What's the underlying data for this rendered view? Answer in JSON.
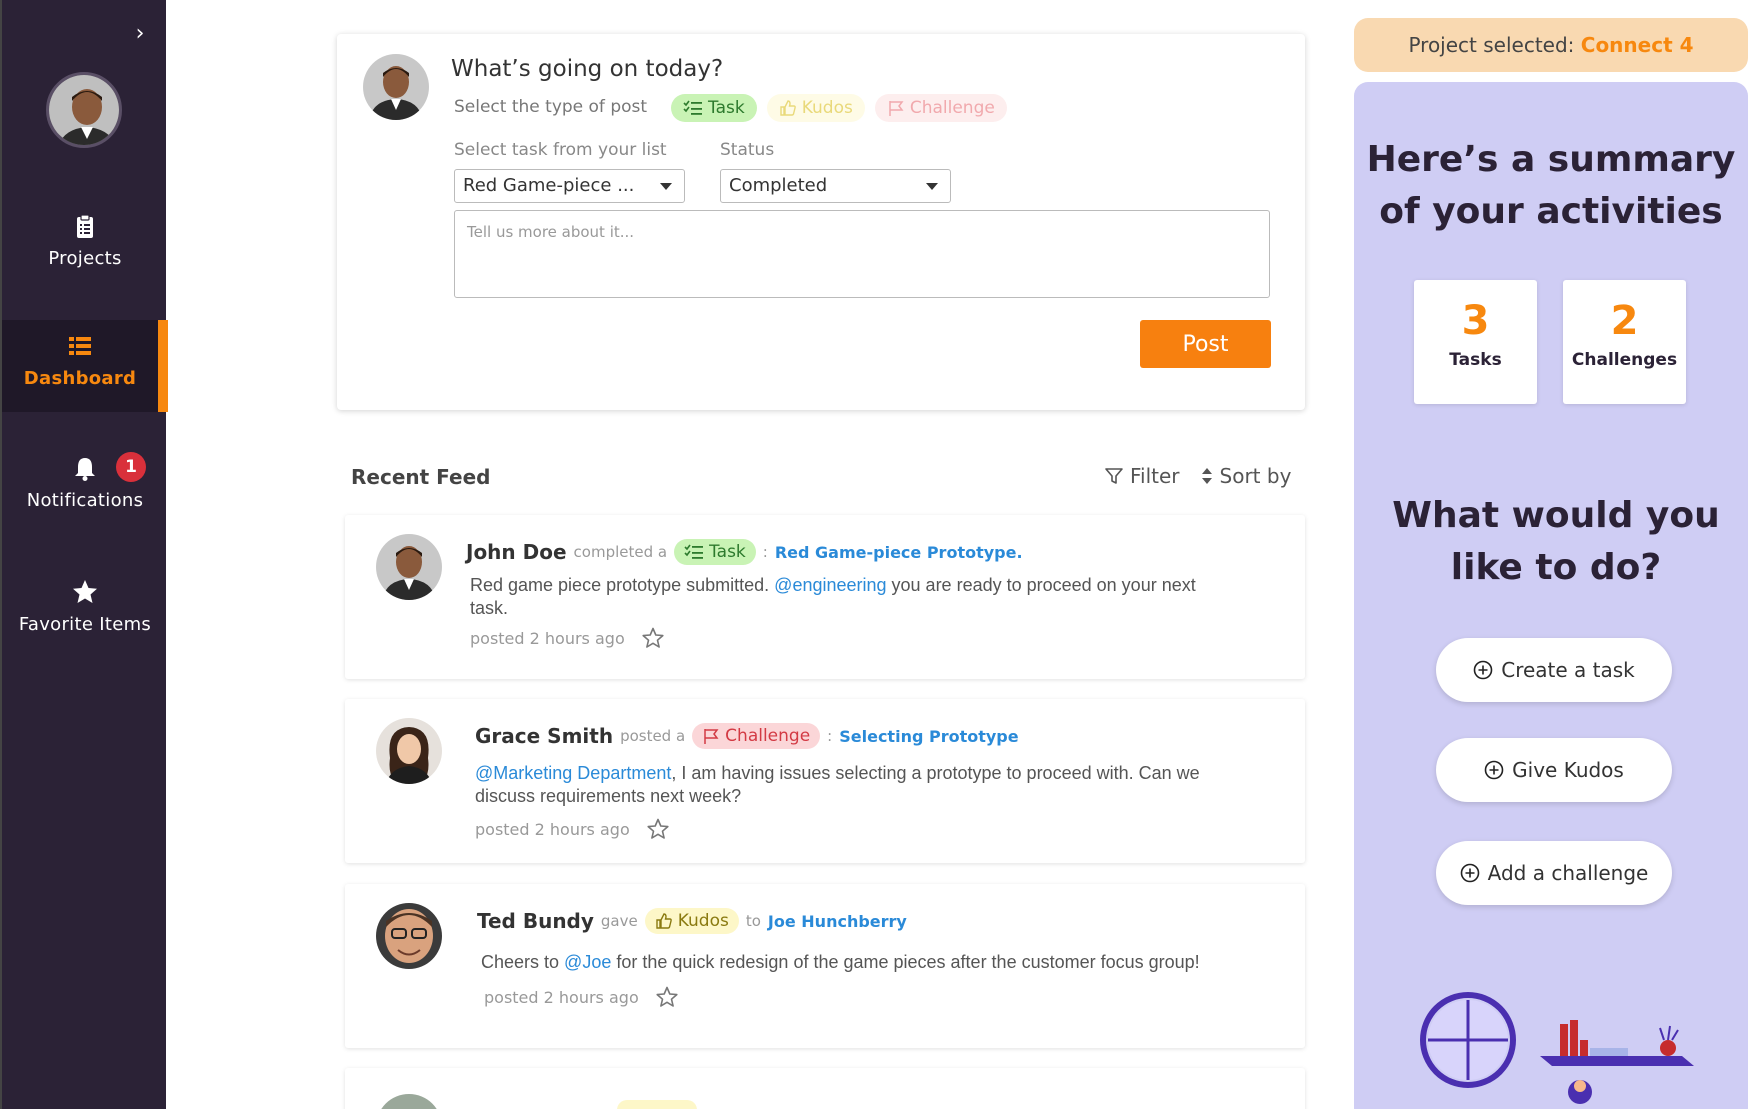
{
  "sidebar": {
    "items": [
      {
        "label": "Projects",
        "icon": "clipboard-icon"
      },
      {
        "label": "Dashboard",
        "icon": "list-icon"
      },
      {
        "label": "Notifications",
        "icon": "bell-icon",
        "badge": "1"
      },
      {
        "label": "Favorite Items",
        "icon": "star-icon"
      }
    ]
  },
  "composer": {
    "title": "What’s going on today?",
    "type_label": "Select the type of post",
    "types": [
      "Task",
      "Kudos",
      "Challenge"
    ],
    "task_label": "Select task from your list",
    "task_value": "Red Game-piece ...",
    "status_label": "Status",
    "status_value": "Completed",
    "text_placeholder": "Tell us more about it...",
    "post_label": "Post"
  },
  "feed": {
    "title": "Recent Feed",
    "filter_label": "Filter",
    "sort_label": "Sort by",
    "items": [
      {
        "name": "John Doe",
        "verb": "completed a",
        "chip": "Task",
        "target": "Red Game-piece Prototype.",
        "body_pre": "Red game piece prototype submitted. ",
        "mention": "@engineering",
        "body_post": " you are ready to proceed on your next task.",
        "meta": "posted 2 hours ago"
      },
      {
        "name": "Grace Smith",
        "verb": "posted a",
        "chip": "Challenge",
        "target": "Selecting Prototype",
        "body_pre": "",
        "mention": "@Marketing Department",
        "body_post": ", I am having issues selecting a prototype to proceed with. Can we discuss requirements next week?",
        "meta": "posted 2 hours ago"
      },
      {
        "name": "Ted Bundy",
        "verb": "gave",
        "chip": "Kudos",
        "connector": "to",
        "target": "Joe Hunchberry",
        "body_pre": "Cheers to ",
        "mention": "@Joe",
        "body_post": " for the quick redesign of the game pieces after the customer focus group!",
        "meta": "posted 2 hours ago"
      }
    ]
  },
  "right": {
    "project_label": "Project selected: ",
    "project_name": "Connect 4",
    "summary_title_1": "Here’s a summary",
    "summary_title_2": "of your activities",
    "stats": [
      {
        "value": "3",
        "label": "Tasks"
      },
      {
        "value": "2",
        "label": "Challenges"
      }
    ],
    "todo_title_1": "What would you",
    "todo_title_2": "like to do?",
    "actions": [
      "Create a task",
      "Give Kudos",
      "Add a challenge"
    ]
  },
  "colors": {
    "sidebar_bg": "#2b2236",
    "accent": "#f7880f",
    "panel_bg": "#cfcdf4",
    "link": "#2a8ad8"
  }
}
